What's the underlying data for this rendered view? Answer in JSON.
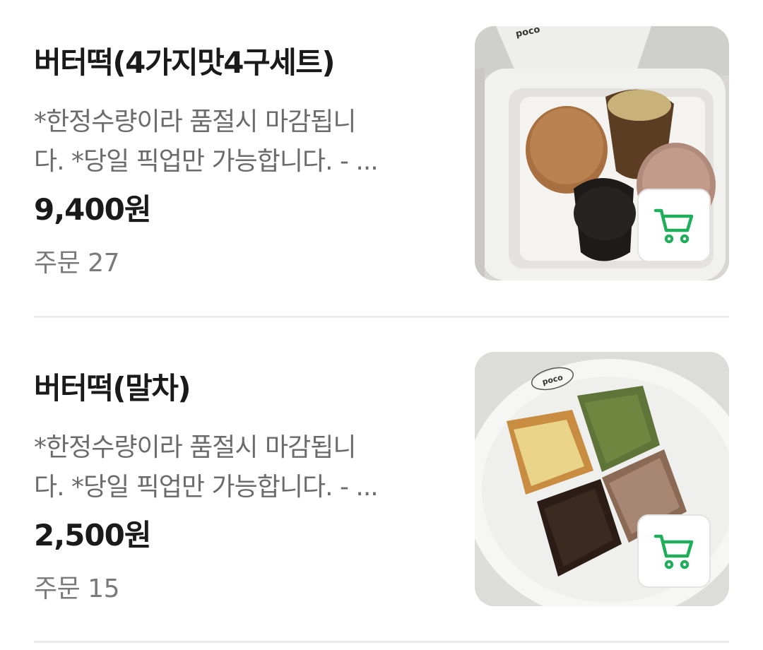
{
  "items": [
    {
      "title": "버터떡(4가지맛4구세트)",
      "desc_line1": "*한정수량이라 품절시 마감됩니",
      "desc_line2": "다. *당일 픽업만 가능합니다. - ...",
      "price": "9,400원",
      "orders": "주문 27",
      "image_logo": "poco",
      "cart_icon": "cart-icon"
    },
    {
      "title": "버터떡(말차)",
      "desc_line1": "*한정수량이라 품절시 마감됩니",
      "desc_line2": "다. *당일 픽업만 가능합니다. - ...",
      "price": "2,500원",
      "orders": "주문 15",
      "image_logo": "poco",
      "cart_icon": "cart-icon"
    }
  ],
  "colors": {
    "cart_accent": "#1fae5a",
    "title": "#1a1a1a",
    "desc": "#6b6b6b",
    "divider": "#ececec"
  }
}
